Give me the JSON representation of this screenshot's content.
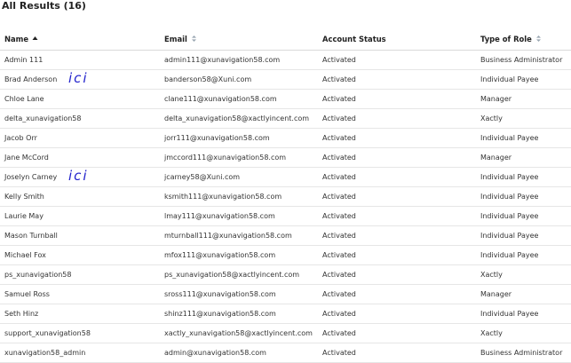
{
  "header": {
    "title": "All Results (16)"
  },
  "table": {
    "columns": [
      {
        "label": "Name",
        "sort": "ascending",
        "sort_icon": "sort-up-icon"
      },
      {
        "label": "Email",
        "sort": "sortable",
        "sort_icon": "sort-both-icon"
      },
      {
        "label": "Account Status",
        "sort": "none",
        "sort_icon": ""
      },
      {
        "label": "Type of Role",
        "sort": "sortable",
        "sort_icon": "sort-both-icon"
      }
    ],
    "rows": [
      {
        "name": "Admin 111",
        "email": "admin111@xunavigation58.com",
        "status": "Activated",
        "role": "Business Administrator"
      },
      {
        "name": "Brad Anderson",
        "email": "banderson58@Xuni.com",
        "status": "Activated",
        "role": "Individual Payee"
      },
      {
        "name": "Chloe Lane",
        "email": "clane111@xunavigation58.com",
        "status": "Activated",
        "role": "Manager"
      },
      {
        "name": "delta_xunavigation58",
        "email": "delta_xunavigation58@xactlyincent.com",
        "status": "Activated",
        "role": "Xactly"
      },
      {
        "name": "Jacob Orr",
        "email": "jorr111@xunavigation58.com",
        "status": "Activated",
        "role": "Individual Payee"
      },
      {
        "name": "Jane McCord",
        "email": "jmccord111@xunavigation58.com",
        "status": "Activated",
        "role": "Manager"
      },
      {
        "name": "Joselyn Carney",
        "email": "jcarney58@Xuni.com",
        "status": "Activated",
        "role": "Individual Payee"
      },
      {
        "name": "Kelly Smith",
        "email": "ksmith111@xunavigation58.com",
        "status": "Activated",
        "role": "Individual Payee"
      },
      {
        "name": "Laurie May",
        "email": "lmay111@xunavigation58.com",
        "status": "Activated",
        "role": "Individual Payee"
      },
      {
        "name": "Mason Turnball",
        "email": "mturnball111@xunavigation58.com",
        "status": "Activated",
        "role": "Individual Payee"
      },
      {
        "name": "Michael Fox",
        "email": "mfox111@xunavigation58.com",
        "status": "Activated",
        "role": "Individual Payee"
      },
      {
        "name": "ps_xunavigation58",
        "email": "ps_xunavigation58@xactlyincent.com",
        "status": "Activated",
        "role": "Xactly"
      },
      {
        "name": "Samuel Ross",
        "email": "sross111@xunavigation58.com",
        "status": "Activated",
        "role": "Manager"
      },
      {
        "name": "Seth Hinz",
        "email": "shinz111@xunavigation58.com",
        "status": "Activated",
        "role": "Individual Payee"
      },
      {
        "name": "support_xunavigation58",
        "email": "xactly_xunavigation58@xactlyincent.com",
        "status": "Activated",
        "role": "Xactly"
      },
      {
        "name": "xunavigation58_admin",
        "email": "admin@xunavigation58.com",
        "status": "Activated",
        "role": "Business Administrator"
      }
    ]
  },
  "annotations": [
    {
      "text": "ici",
      "row_index": 1
    },
    {
      "text": "ici",
      "row_index": 6
    }
  ],
  "colors": {
    "annotation": "#2222cc",
    "border": "#e6e6e6",
    "text": "#333333"
  }
}
